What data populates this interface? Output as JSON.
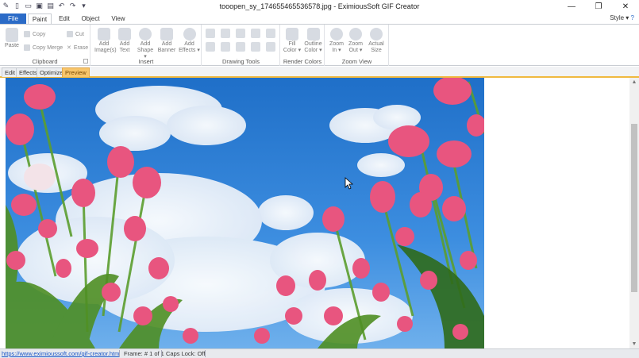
{
  "window": {
    "title": "tooopen_sy_174655465536578.jpg - EximiousSoft GIF Creator",
    "controls": [
      "minimize",
      "maximize",
      "close"
    ]
  },
  "quick_access": [
    "app-icon",
    "new-icon",
    "open-icon",
    "save-icon",
    "save-as-icon",
    "undo-icon",
    "redo-icon",
    "customize-icon"
  ],
  "menu_tabs": {
    "file": "File",
    "paint": "Paint",
    "edit": "Edit",
    "object": "Object",
    "view": "View",
    "style": "Style"
  },
  "ribbon": {
    "clipboard": {
      "label": "Clipboard",
      "paste": "Paste",
      "copy": "Copy",
      "copy_merge": "Copy Merge",
      "cut": "Cut",
      "erase": "Erase"
    },
    "insert": {
      "label": "Insert",
      "add_images_1": "Add",
      "add_images_2": "Image(s)",
      "add_text_1": "Add",
      "add_text_2": "Text",
      "add_shape_1": "Add",
      "add_shape_2": "Shape",
      "add_banner_1": "Add",
      "add_banner_2": "Banner",
      "add_effects_1": "Add",
      "add_effects_2": "Effects"
    },
    "drawing_tools": {
      "label": "Drawing Tools"
    },
    "render_colors": {
      "label": "Render Colors",
      "fill_1": "Fill",
      "fill_2": "Color",
      "outline_1": "Outline",
      "outline_2": "Color"
    },
    "zoom_view": {
      "label": "Zoom View",
      "zoom_in_1": "Zoom",
      "zoom_in_2": "In",
      "zoom_out_1": "Zoom",
      "zoom_out_2": "Out",
      "actual_1": "Actual",
      "actual_2": "Size"
    }
  },
  "subtabs": [
    "Edit",
    "Effects",
    "Optimize",
    "Preview"
  ],
  "status": {
    "link": "https://www.eximioussoft.com/gif-creator.htm",
    "frame": "Frame: # 1 of 1",
    "caps": "Caps Lock: Off"
  },
  "colors": {
    "file_tab": "#2b6bc7",
    "active_subtab": "#f7c56b",
    "sky": "#2f7fd6",
    "tulip": "#e8557f",
    "stem": "#5a9a2e"
  }
}
